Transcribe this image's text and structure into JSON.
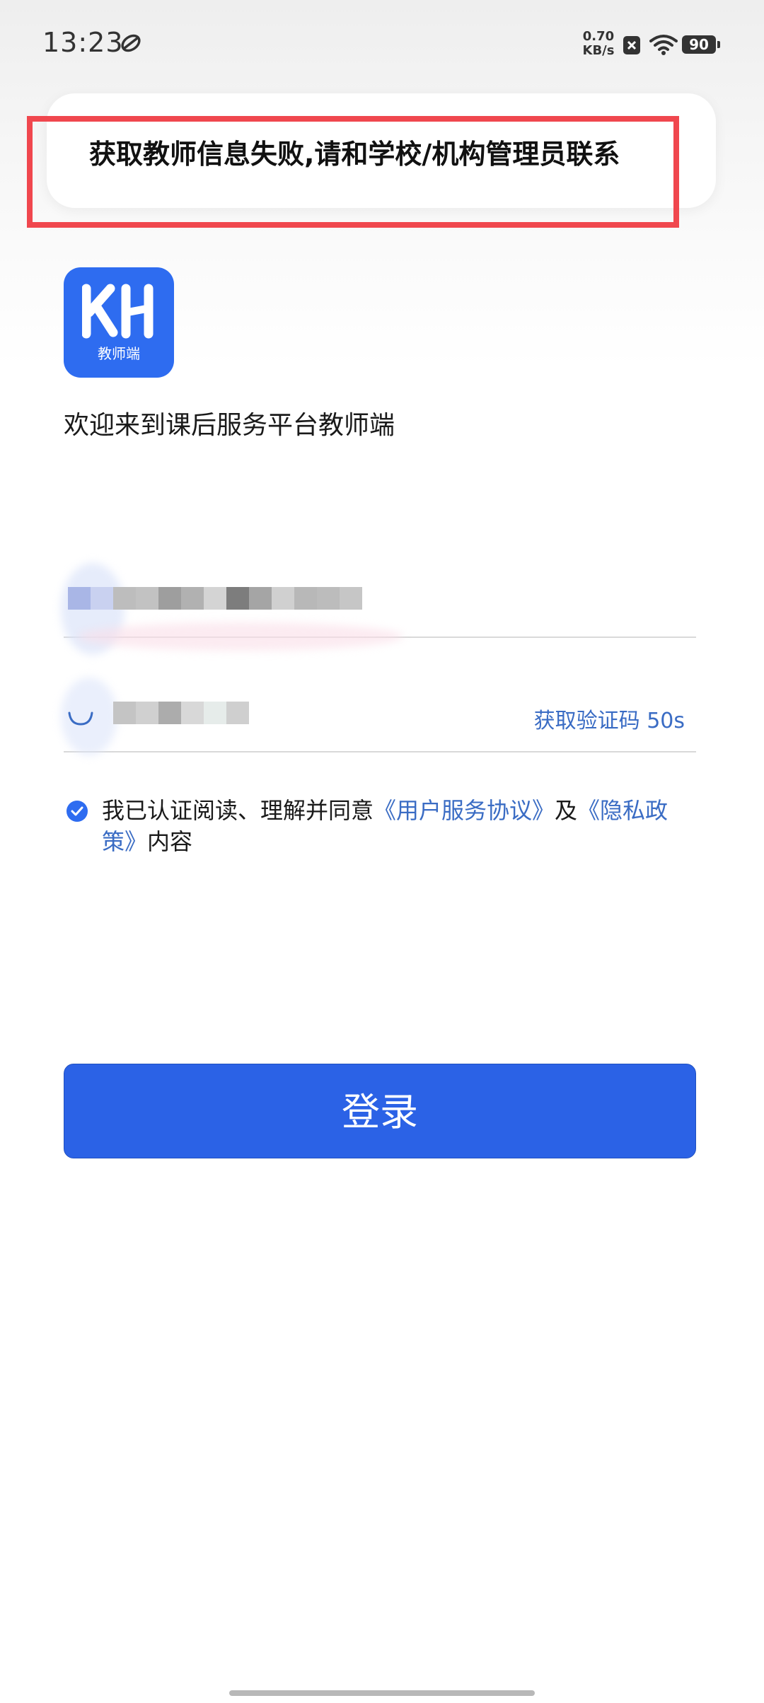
{
  "status_bar": {
    "time": "13:23",
    "net_speed_value": "0.70",
    "net_speed_unit": "KB/s",
    "battery": "90"
  },
  "toast": {
    "message": "获取教师信息失败,请和学校/机构管理员联系"
  },
  "app": {
    "logo_caption": "教师端",
    "welcome": "欢迎来到课后服务平台教师端"
  },
  "form": {
    "get_code_label": "获取验证码 50s"
  },
  "agreement": {
    "prefix": "我已认证阅读、理解并同意",
    "user_agreement": "《用户服务协议》",
    "and": "及",
    "privacy_policy": "《隐私政策》",
    "suffix": "内容"
  },
  "login": {
    "label": "登录"
  }
}
